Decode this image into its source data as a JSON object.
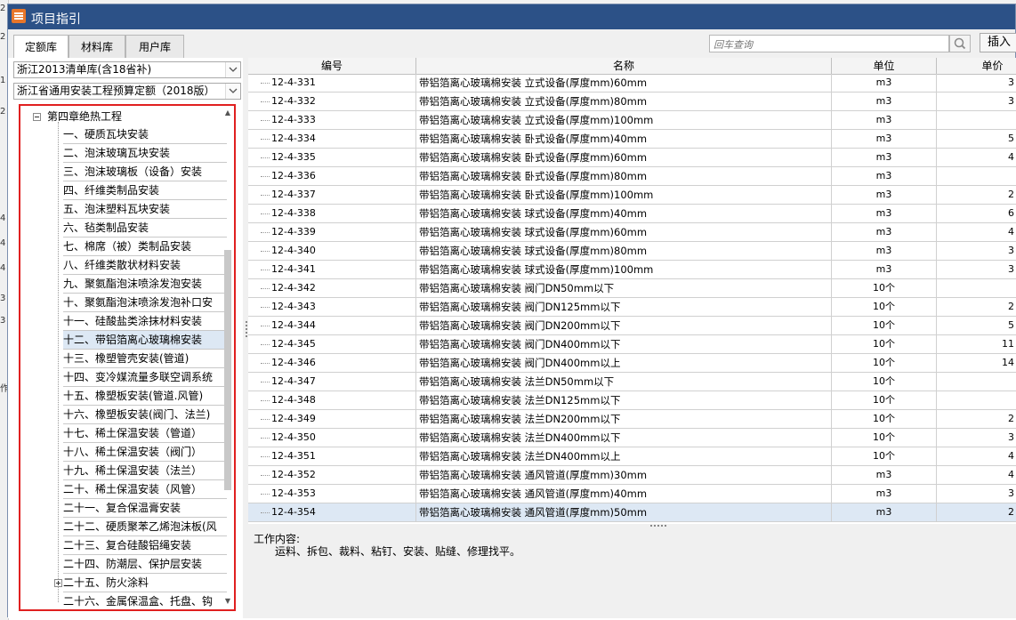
{
  "window": {
    "title": "项目指引"
  },
  "tabs": [
    {
      "label": "定额库",
      "active": true
    },
    {
      "label": "材料库"
    },
    {
      "label": "用户库"
    }
  ],
  "search": {
    "placeholder": "回车查询"
  },
  "insert_button": "插入",
  "combos": {
    "library": "浙江2013清单库(含18省补)",
    "quota": "浙江省通用安装工程预算定额（2018版）"
  },
  "tree": {
    "root": "第四章绝热工程",
    "items": [
      "一、硬质瓦块安装",
      "二、泡沫玻璃瓦块安装",
      "三、泡沫玻璃板（设备）安装",
      "四、纤维类制品安装",
      "五、泡沫塑料瓦块安装",
      "六、毡类制品安装",
      "七、棉席（被）类制品安装",
      "八、纤维类散状材料安装",
      "九、聚氨酯泡沫喷涂发泡安装",
      "十、聚氨酯泡沫喷涂发泡补口安",
      "十一、硅酸盐类涂抹材料安装",
      "十二、带铝箔离心玻璃棉安装",
      "十三、橡塑管壳安装(管道)",
      "十四、变冷媒流量多联空调系统",
      "十五、橡塑板安装(管道.风管)",
      "十六、橡塑板安装(阀门、法兰)",
      "十七、稀土保温安装（管道）",
      "十八、稀土保温安装（阀门）",
      "十九、稀土保温安装（法兰）",
      "二十、稀土保温安装（风管）",
      "二十一、复合保温膏安装",
      "二十二、硬质聚苯乙烯泡沫板(风",
      "二十三、复合硅酸铝绳安装",
      "二十四、防潮层、保护层安装",
      "二十五、防火涂料",
      "二十六、金属保温盒、托盘、钩"
    ],
    "selected_index": 11,
    "expandable_index": 24
  },
  "grid": {
    "columns": [
      "编号",
      "名称",
      "单位",
      "单价"
    ],
    "rows": [
      {
        "no": "12-4-331",
        "name": "带铝箔离心玻璃棉安装 立式设备(厚度mm)60mm",
        "unit": "m3",
        "price": "3"
      },
      {
        "no": "12-4-332",
        "name": "带铝箔离心玻璃棉安装 立式设备(厚度mm)80mm",
        "unit": "m3",
        "price": "3"
      },
      {
        "no": "12-4-333",
        "name": "带铝箔离心玻璃棉安装 立式设备(厚度mm)100mm",
        "unit": "m3",
        "price": ""
      },
      {
        "no": "12-4-334",
        "name": "带铝箔离心玻璃棉安装 卧式设备(厚度mm)40mm",
        "unit": "m3",
        "price": "5"
      },
      {
        "no": "12-4-335",
        "name": "带铝箔离心玻璃棉安装 卧式设备(厚度mm)60mm",
        "unit": "m3",
        "price": "4"
      },
      {
        "no": "12-4-336",
        "name": "带铝箔离心玻璃棉安装 卧式设备(厚度mm)80mm",
        "unit": "m3",
        "price": ""
      },
      {
        "no": "12-4-337",
        "name": "带铝箔离心玻璃棉安装 卧式设备(厚度mm)100mm",
        "unit": "m3",
        "price": "2"
      },
      {
        "no": "12-4-338",
        "name": "带铝箔离心玻璃棉安装 球式设备(厚度mm)40mm",
        "unit": "m3",
        "price": "6"
      },
      {
        "no": "12-4-339",
        "name": "带铝箔离心玻璃棉安装 球式设备(厚度mm)60mm",
        "unit": "m3",
        "price": "4"
      },
      {
        "no": "12-4-340",
        "name": "带铝箔离心玻璃棉安装 球式设备(厚度mm)80mm",
        "unit": "m3",
        "price": "3"
      },
      {
        "no": "12-4-341",
        "name": "带铝箔离心玻璃棉安装 球式设备(厚度mm)100mm",
        "unit": "m3",
        "price": "3"
      },
      {
        "no": "12-4-342",
        "name": "带铝箔离心玻璃棉安装 阀门DN50mm以下",
        "unit": "10个",
        "price": ""
      },
      {
        "no": "12-4-343",
        "name": "带铝箔离心玻璃棉安装 阀门DN125mm以下",
        "unit": "10个",
        "price": "2"
      },
      {
        "no": "12-4-344",
        "name": "带铝箔离心玻璃棉安装 阀门DN200mm以下",
        "unit": "10个",
        "price": "5"
      },
      {
        "no": "12-4-345",
        "name": "带铝箔离心玻璃棉安装 阀门DN400mm以下",
        "unit": "10个",
        "price": "11"
      },
      {
        "no": "12-4-346",
        "name": "带铝箔离心玻璃棉安装 阀门DN400mm以上",
        "unit": "10个",
        "price": "14"
      },
      {
        "no": "12-4-347",
        "name": "带铝箔离心玻璃棉安装 法兰DN50mm以下",
        "unit": "10个",
        "price": ""
      },
      {
        "no": "12-4-348",
        "name": "带铝箔离心玻璃棉安装 法兰DN125mm以下",
        "unit": "10个",
        "price": ""
      },
      {
        "no": "12-4-349",
        "name": "带铝箔离心玻璃棉安装 法兰DN200mm以下",
        "unit": "10个",
        "price": "2"
      },
      {
        "no": "12-4-350",
        "name": "带铝箔离心玻璃棉安装 法兰DN400mm以下",
        "unit": "10个",
        "price": "3"
      },
      {
        "no": "12-4-351",
        "name": "带铝箔离心玻璃棉安装 法兰DN400mm以上",
        "unit": "10个",
        "price": "4"
      },
      {
        "no": "12-4-352",
        "name": "带铝箔离心玻璃棉安装 通风管道(厚度mm)30mm",
        "unit": "m3",
        "price": "4"
      },
      {
        "no": "12-4-353",
        "name": "带铝箔离心玻璃棉安装 通风管道(厚度mm)40mm",
        "unit": "m3",
        "price": "3"
      },
      {
        "no": "12-4-354",
        "name": "带铝箔离心玻璃棉安装 通风管道(厚度mm)50mm",
        "unit": "m3",
        "price": "2"
      }
    ],
    "selected_index": 23
  },
  "work_content": {
    "label": "工作内容:",
    "text": "运料、拆包、裁料、粘钉、安装、贴缝、修理找平。"
  },
  "background_app": {
    "left_marks": [
      "2",
      "2",
      "1",
      "2",
      "4",
      "4",
      "4",
      "3",
      "3",
      "作"
    ]
  },
  "colors": {
    "titlebar": "#2c5187",
    "highlight": "#dde8f4",
    "tree_border": "#e02020"
  }
}
